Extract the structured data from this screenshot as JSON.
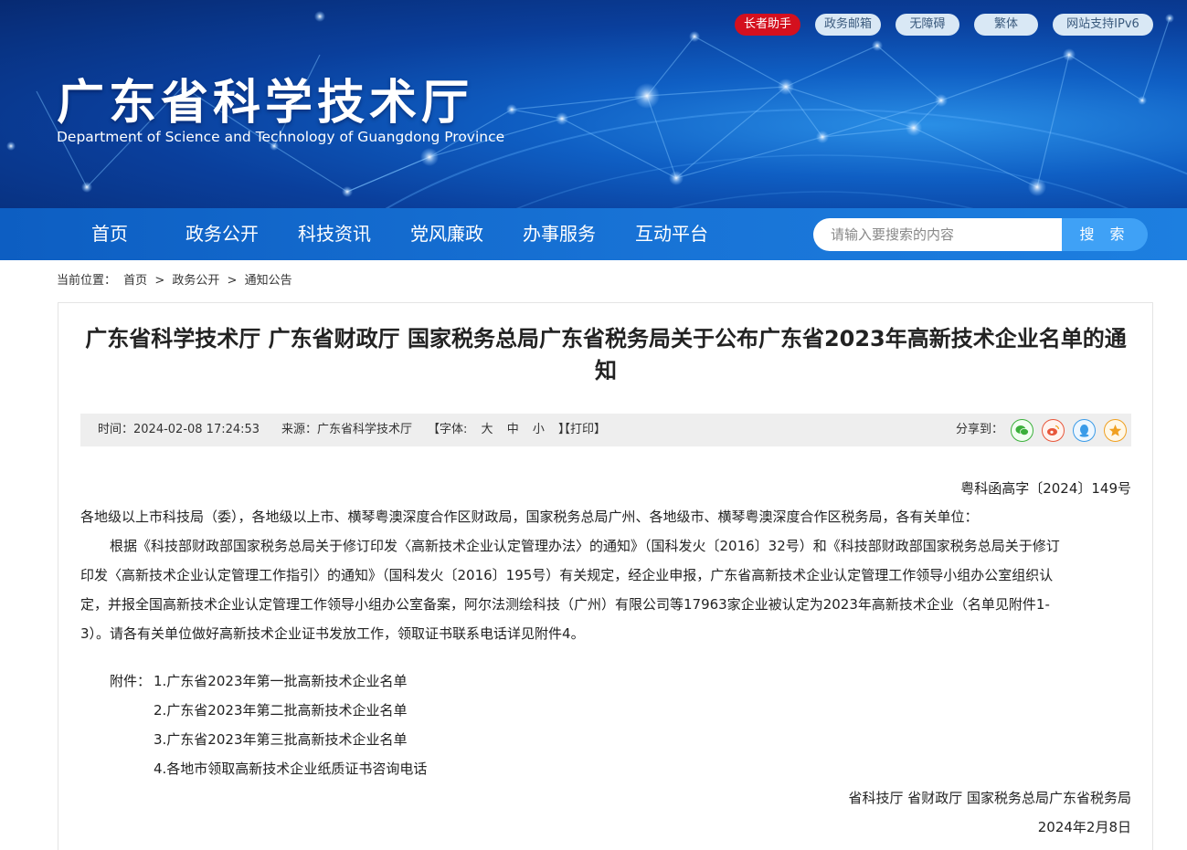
{
  "top_links": [
    "长者助手",
    "政务邮箱",
    "无障碍",
    "繁体",
    "网站支持IPv6"
  ],
  "site": {
    "title": "广东省科学技术厅",
    "subtitle": "Department of Science and Technology of Guangdong Province"
  },
  "nav": {
    "items": [
      "首页",
      "政务公开",
      "科技资讯",
      "党风廉政",
      "办事服务",
      "互动平台"
    ],
    "search_placeholder": "请输入要搜索的内容",
    "search_button": "搜 索"
  },
  "breadcrumb": {
    "label": "当前位置：",
    "items": [
      "首页",
      "政务公开",
      "通知公告"
    ],
    "sep": ">"
  },
  "article": {
    "title": "广东省科学技术厅 广东省财政厅 国家税务总局广东省税务局关于公布广东省2023年高新技术企业名单的通知",
    "meta": {
      "time": "时间：2024-02-08 17:24:53",
      "source": "来源：广东省科学技术厅",
      "font_label": "【字体:",
      "font_sizes": [
        "大",
        "中",
        "小"
      ],
      "font_end": "】",
      "print": "【打印】",
      "share": "分享到："
    },
    "doc_number": "粤科函高字〔2024〕149号",
    "salutation": "各地级以上市科技局（委），各地级以上市、横琴粤澳深度合作区财政局，国家税务总局广州、各地级市、横琴粤澳深度合作区税务局，各有关单位：",
    "paragraph_lines": [
      "根据《科技部财政部国家税务总局关于修订印发〈高新技术企业认定管理办法〉的通知》（国科发火〔2016〕32号）和《科技部财政部国家税务总局关于修订",
      "印发〈高新技术企业认定管理工作指引〉的通知》（国科发火〔2016〕195号）有关规定，经企业申报，广东省高新技术企业认定管理工作领导小组办公室组织认",
      "定，并报全国高新技术企业认定管理工作领导小组办公室备案，阿尔法测绘科技（广州）有限公司等17963家企业被认定为2023年高新技术企业（名单见附件1-",
      "3）。请各有关单位做好高新技术企业证书发放工作，领取证书联系电话详见附件4。"
    ],
    "attachments_label": "附件：",
    "attachments": [
      "1.广东省2023年第一批高新技术企业名单",
      "2.广东省2023年第二批高新技术企业名单",
      "3.广东省2023年第三批高新技术企业名单",
      "4.各地市领取高新技术企业纸质证书咨询电话"
    ],
    "signature": "省科技厅 省财政厅 国家税务总局广东省税务局",
    "date": "2024年2月8日"
  },
  "colors": {
    "banner_dark": "#072a72",
    "banner_light": "#2a8fe6",
    "nav_blue": "#1873d6",
    "search_button": "#3fa1f6",
    "elder_red": "#d4101e",
    "wechat": "#3bb03b",
    "weibo": "#e8563a",
    "qq": "#3a9be8",
    "favorite": "#f0a020"
  }
}
